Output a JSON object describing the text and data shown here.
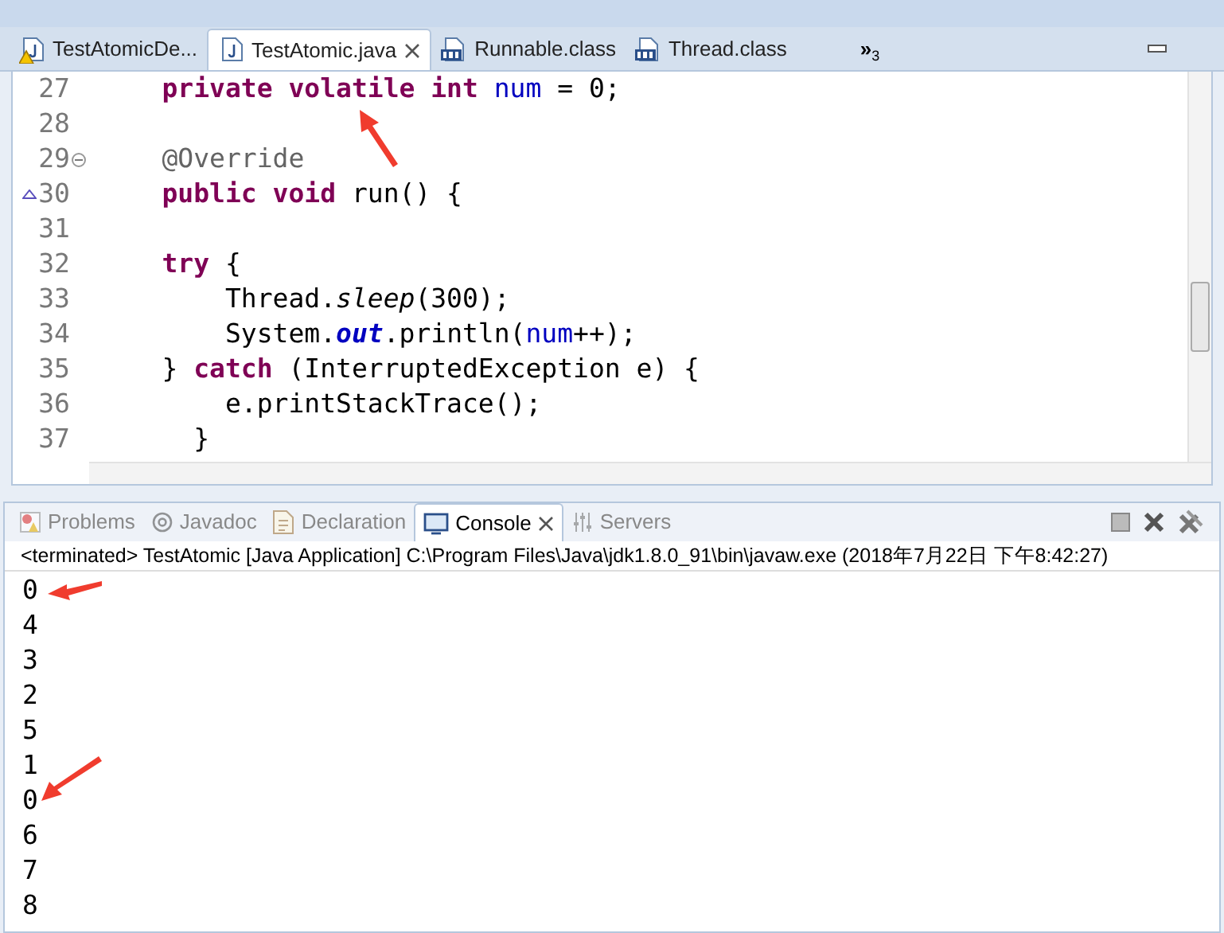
{
  "editor_tabs": [
    {
      "label": "TestAtomicDe...",
      "kind": "java_source_warning",
      "selected": false,
      "closable": false
    },
    {
      "label": "TestAtomic.java",
      "kind": "java_source",
      "selected": true,
      "closable": true
    },
    {
      "label": "Runnable.class",
      "kind": "class_file",
      "selected": false,
      "closable": false
    },
    {
      "label": "Thread.class",
      "kind": "class_file",
      "selected": false,
      "closable": false
    }
  ],
  "overflow": {
    "symbol": "»",
    "count": "3"
  },
  "code_lines": [
    {
      "number": "27",
      "kind": "plain",
      "tokens": [
        {
          "text": "    private",
          "kind": "keyword"
        },
        {
          "text": " volatile",
          "kind": "keyword"
        },
        {
          "text": " int",
          "kind": "keyword"
        },
        {
          "text": " num",
          "kind": "field"
        },
        {
          "text": " = 0;",
          "kind": "plain"
        }
      ]
    },
    {
      "number": "28",
      "kind": "plain"
    },
    {
      "number": "29",
      "kind": "fold",
      "tokens": [
        {
          "text": "    @Override",
          "kind": "annotation"
        }
      ]
    },
    {
      "number": "30",
      "kind": "override",
      "tokens": [
        {
          "text": "    public",
          "kind": "keyword"
        },
        {
          "text": " void",
          "kind": "keyword"
        },
        {
          "text": " run() {",
          "kind": "plain"
        }
      ]
    },
    {
      "number": "31",
      "kind": "plain"
    },
    {
      "number": "32",
      "kind": "plain",
      "tokens": [
        {
          "text": "    try",
          "kind": "keyword"
        },
        {
          "text": " {",
          "kind": "plain"
        }
      ]
    },
    {
      "number": "33",
      "kind": "plain",
      "tokens": [
        {
          "text": "        Thread.",
          "kind": "plain"
        },
        {
          "text": "sleep",
          "kind": "static_method"
        },
        {
          "text": "(300);",
          "kind": "plain"
        }
      ]
    },
    {
      "number": "34",
      "kind": "plain",
      "tokens": [
        {
          "text": "        System.",
          "kind": "plain"
        },
        {
          "text": "out",
          "kind": "static_field"
        },
        {
          "text": ".println(",
          "kind": "plain"
        },
        {
          "text": "num",
          "kind": "field"
        },
        {
          "text": "++);",
          "kind": "plain"
        }
      ]
    },
    {
      "number": "35",
      "kind": "plain",
      "tokens": [
        {
          "text": "    } ",
          "kind": "plain"
        },
        {
          "text": "catch",
          "kind": "keyword"
        },
        {
          "text": " (InterruptedException e) {",
          "kind": "plain"
        }
      ]
    },
    {
      "number": "36",
      "kind": "plain",
      "tokens": [
        {
          "text": "        e.printStackTrace();",
          "kind": "plain"
        }
      ]
    },
    {
      "number": "37",
      "kind": "plain",
      "tokens": [
        {
          "text": "      }",
          "kind": "plain"
        }
      ]
    }
  ],
  "panel_tabs": [
    {
      "label": "Problems",
      "kind": "problems",
      "selected": false,
      "closable": false
    },
    {
      "label": "Javadoc",
      "kind": "javadoc",
      "selected": false,
      "closable": false
    },
    {
      "label": "Declaration",
      "kind": "declaration",
      "selected": false,
      "closable": false
    },
    {
      "label": "Console",
      "kind": "console",
      "selected": true,
      "closable": true
    },
    {
      "label": "Servers",
      "kind": "servers",
      "selected": false,
      "closable": false
    }
  ],
  "console": {
    "header": "<terminated> TestAtomic [Java Application] C:\\Program Files\\Java\\jdk1.8.0_91\\bin\\javaw.exe (2018年7月22日 下午8:42:27)",
    "output": [
      {
        "text": "0",
        "arrow": true
      },
      {
        "text": "4",
        "arrow": false
      },
      {
        "text": "3",
        "arrow": false
      },
      {
        "text": "2",
        "arrow": false
      },
      {
        "text": "5",
        "arrow": false
      },
      {
        "text": "1",
        "arrow": false
      },
      {
        "text": "0",
        "arrow": true
      },
      {
        "text": "6",
        "arrow": false
      },
      {
        "text": "7",
        "arrow": false
      },
      {
        "text": "8",
        "arrow": false
      }
    ]
  }
}
